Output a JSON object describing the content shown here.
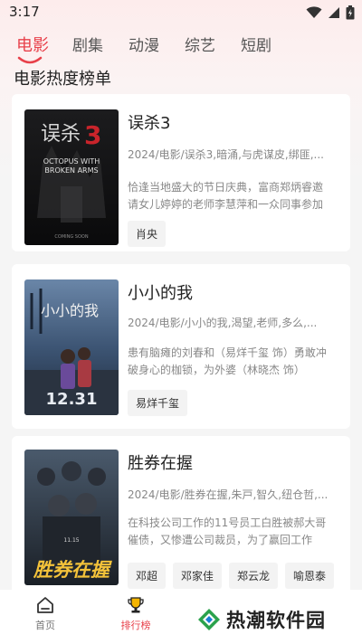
{
  "status_bar": {
    "time": "3:17"
  },
  "tabs": [
    {
      "label": "电影",
      "active": true
    },
    {
      "label": "剧集",
      "active": false
    },
    {
      "label": "动漫",
      "active": false
    },
    {
      "label": "综艺",
      "active": false
    },
    {
      "label": "短剧",
      "active": false
    }
  ],
  "section_title": "电影热度榜单",
  "movies": [
    {
      "title": "误杀3",
      "meta": "2024/电影/误杀3,暗涌,与虎谋皮,绑匪,...",
      "desc": "恰逢当地盛大的节日庆典，富商郑炳睿邀请女儿婷婷的老师李慧萍和一众同事参加",
      "actors": [
        "肖央"
      ],
      "poster": {
        "title_cn": "误杀",
        "num": "3",
        "en1": "OCTOPUS WITH",
        "en2": "BROKEN ARMS",
        "footer": "COMING SOON"
      }
    },
    {
      "title": "小小的我",
      "meta": "2024/电影/小小的我,渴望,老师,多么,...",
      "desc": "患有脑瘫的刘春和（易烊千玺 饰）勇敢冲破身心的枷锁，为外婆（林晓杰 饰）",
      "actors": [
        "易烊千玺"
      ],
      "poster": {
        "title_cn": "小小的我",
        "date": "12.31"
      }
    },
    {
      "title": "胜券在握",
      "meta": "2024/电影/胜券在握,朱戸,智久,纽仓哲,...",
      "desc": "在科技公司工作的11号员工白胜被郝大哥催债，又惨遭公司裁员，为了赢回工作",
      "actors": [
        "邓超",
        "邓家佳",
        "郑云龙",
        "喻恩泰"
      ],
      "poster": {
        "title_cn": "胜券在握",
        "date": "11.15"
      }
    }
  ],
  "bottom_nav": [
    {
      "label": "首页",
      "icon": "home-icon",
      "active": false
    },
    {
      "label": "排行榜",
      "icon": "trophy-icon",
      "active": true
    }
  ],
  "watermark": {
    "text": "热潮软件园"
  },
  "colors": {
    "accent": "#e8404a",
    "background": "#f5f5f5",
    "card": "#ffffff"
  }
}
